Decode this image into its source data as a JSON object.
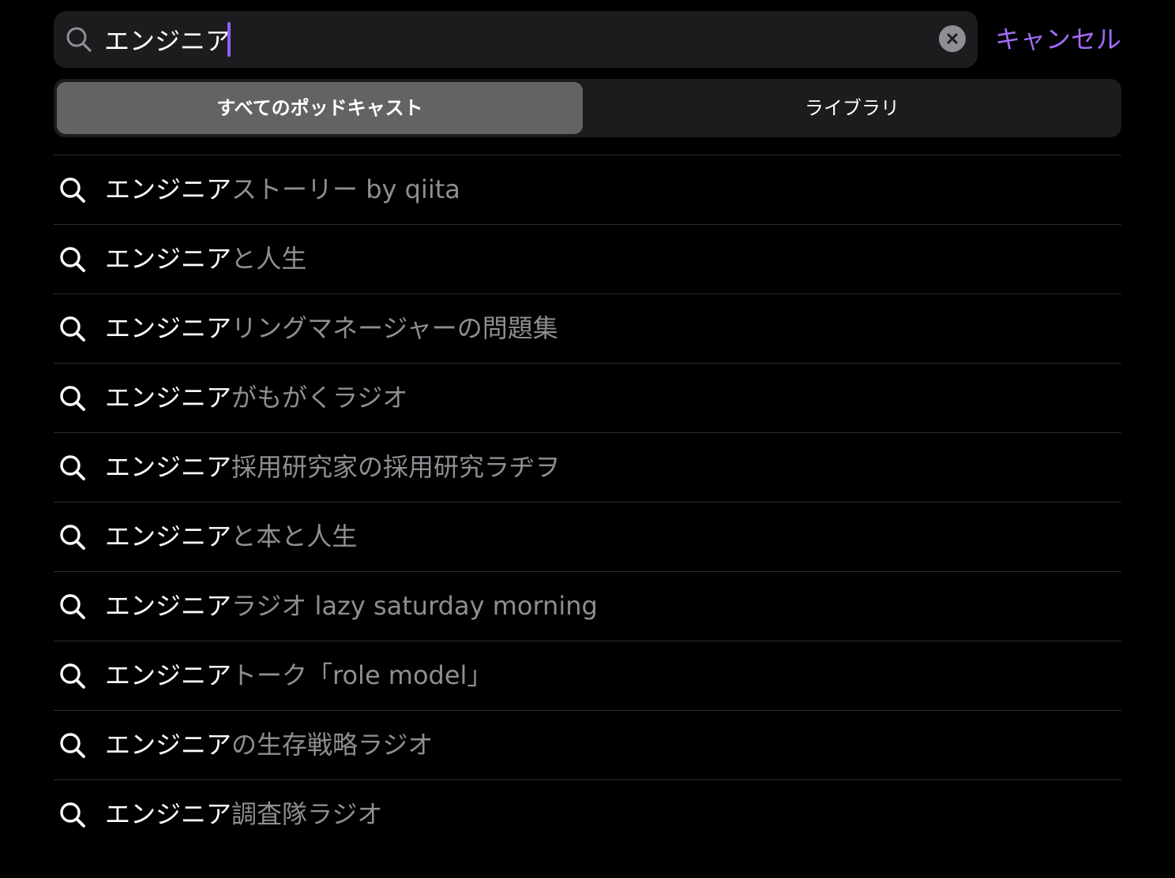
{
  "search": {
    "query": "エンジニア",
    "cancel_label": "キャンセル"
  },
  "scope": {
    "tabs": [
      {
        "label": "すべてのポッドキャスト",
        "selected": true
      },
      {
        "label": "ライブラリ",
        "selected": false
      }
    ]
  },
  "suggestions": [
    {
      "typed": "エンジニア",
      "rest": "ストーリー by qiita"
    },
    {
      "typed": "エンジニア",
      "rest": "と人生"
    },
    {
      "typed": "エンジニア",
      "rest": "リングマネージャーの問題集"
    },
    {
      "typed": "エンジニア",
      "rest": "がもがくラジオ"
    },
    {
      "typed": "エンジニア",
      "rest": "採用研究家の採用研究ラヂヲ"
    },
    {
      "typed": "エンジニア",
      "rest": "と本と人生"
    },
    {
      "typed": "エンジニア",
      "rest": "ラジオ lazy saturday morning"
    },
    {
      "typed": "エンジニア",
      "rest": "トーク「role model」"
    },
    {
      "typed": "エンジニア",
      "rest": "の生存戦略ラジオ"
    },
    {
      "typed": "エンジニア",
      "rest": "調査隊ラジオ"
    }
  ],
  "icons": {
    "search_field": "search-icon",
    "clear": "clear-icon",
    "suggestion": "search-icon"
  },
  "colors": {
    "accent": "#a26bf7",
    "background": "#000000",
    "field_background": "#1c1c1e",
    "selected_segment": "#636366",
    "secondary_text": "#8e8e93"
  }
}
